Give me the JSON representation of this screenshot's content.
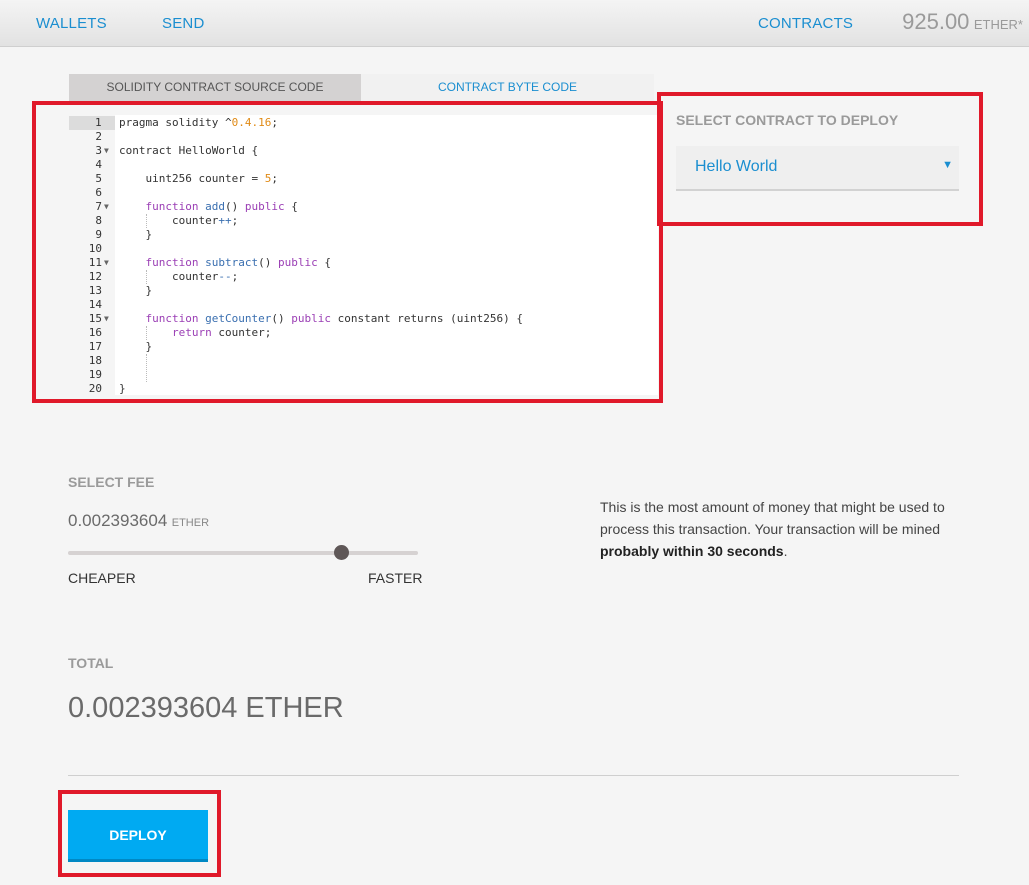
{
  "nav": {
    "wallets": "WALLETS",
    "send": "SEND",
    "contracts": "CONTRACTS",
    "balance_amount": "925.00",
    "balance_unit": "ETHER*"
  },
  "tabs": {
    "source": "SOLIDITY CONTRACT SOURCE CODE",
    "bytecode": "CONTRACT BYTE CODE"
  },
  "code": {
    "lines": [
      "pragma solidity ^0.4.16;",
      "",
      "contract HelloWorld {",
      "",
      "    uint256 counter = 5;",
      "",
      "    function add() public {",
      "        counter++;",
      "    }",
      "",
      "    function subtract() public {",
      "        counter--;",
      "    }",
      "",
      "    function getCounter() public constant returns (uint256) {",
      "        return counter;",
      "    }",
      "",
      "",
      "}"
    ],
    "active_line": 1
  },
  "select_contract": {
    "label": "SELECT CONTRACT TO DEPLOY",
    "value": "Hello World"
  },
  "fee": {
    "label": "SELECT FEE",
    "amount": "0.002393604",
    "unit": "ETHER",
    "slider_position": 0.78,
    "cheaper": "CHEAPER",
    "faster": "FASTER",
    "description_prefix": "This is the most amount of money that might be used to process this transaction. Your transaction will be mined ",
    "description_bold": "probably within 30 seconds",
    "description_suffix": "."
  },
  "total": {
    "label": "TOTAL",
    "value": "0.002393604 ETHER"
  },
  "deploy": {
    "label": "DEPLOY"
  },
  "colors": {
    "accent": "#1a8ed0",
    "deploy_button": "#00aaf2",
    "highlight": "#e0192a"
  }
}
